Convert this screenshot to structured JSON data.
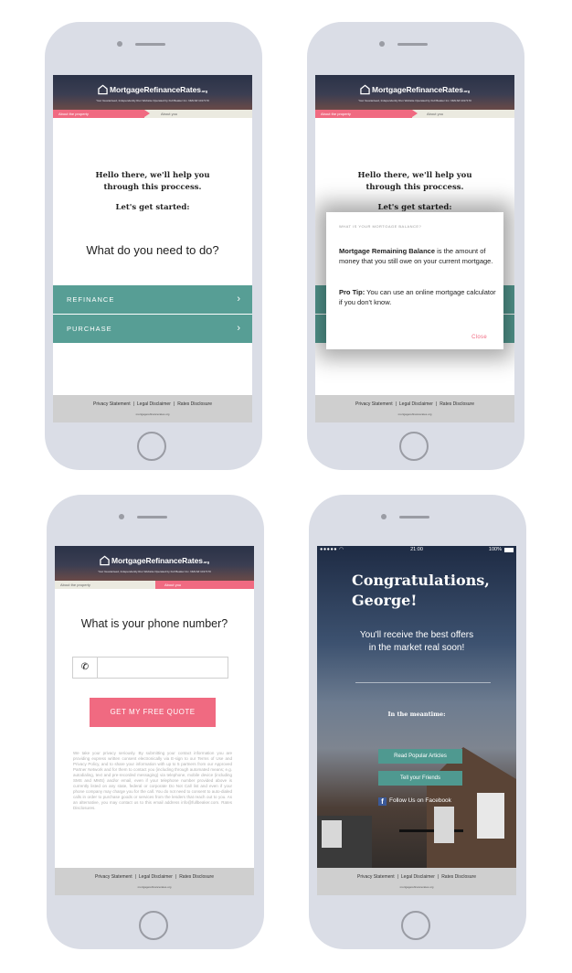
{
  "brand": {
    "name": "MortgageRefinanceRates",
    "suffix": ".org",
    "tagline": "Your Guaranteed, Independently Run Website Operated by Full Beaker Inc. NMLS# 1017170"
  },
  "progress": {
    "step1": "About the property",
    "step2": "About you"
  },
  "footer": {
    "links": [
      "Privacy Statement",
      "Legal Disclaimer",
      "Rates Disclosure"
    ],
    "url": "mortgagerefinancerates.org"
  },
  "screen1": {
    "greeting_line1": "Hello there, we'll help you",
    "greeting_line2": "through this proccess.",
    "start": "Let's get started:",
    "question": "What do you need to do?",
    "options": [
      "REFINANCE",
      "PURCHASE"
    ]
  },
  "screen2": {
    "modal_title": "WHAT IS YOUR MORTGAGE BALANCE?",
    "term": "Mortgage Remaining Balance",
    "definition": " is the amount of money that you still owe on your current mortgage.",
    "tip_label": "Pro Tip:",
    "tip_text": " You can use an online mortgage calculator if you don't know.",
    "close": "Close"
  },
  "screen3": {
    "question": "What is your phone number?",
    "phone_value": "",
    "cta": "GET MY FREE QUOTE",
    "legal": "We take your privacy seriously. By submitting your contact information you are providing express written consent electronically via E-sign to our Terms of Use and Privacy Policy, and to share your information with up to 5 partners from our Approved Partner Network and for them to contact you (including through automated means; e.g. autodialing, text and pre-recorded messaging) via telephone, mobile device (including SMS and MMS) and/or email, even if your telephone number provided above is currently listed on any state, federal or corporate Do Not Call list and even if your phone company may charge you for the call. You do not need to consent to auto-dialed calls in order to purchase goods or services from the lenders that reach out to you. As an alternative, you may contact us to this email address info@fullbeaker.com. Rates Disclosures."
  },
  "screen4": {
    "time": "21:00",
    "battery": "100%",
    "title_line1": "Congratulations,",
    "title_line2": "George!",
    "sub_line1": "You'll receive the best offers",
    "sub_line2": "in the market real soon!",
    "meantime": "In the meantime:",
    "btn1": "Read Popular Articles",
    "btn2": "Tell your Friends",
    "facebook": "Follow Us on Facebook"
  },
  "colors": {
    "pink": "#f06a81",
    "teal": "#579e95",
    "phone": "#dadde6"
  }
}
